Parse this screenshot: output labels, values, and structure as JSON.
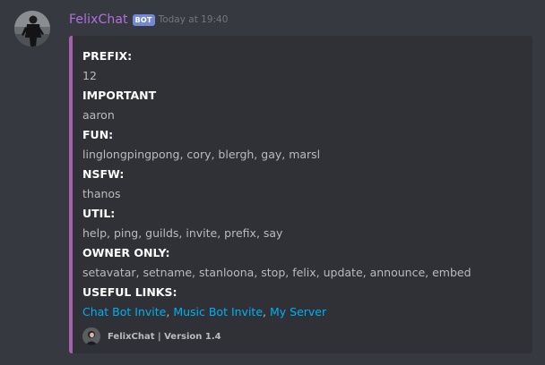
{
  "message": {
    "username": "FelixChat",
    "bot_tag": "BOT",
    "timestamp": "Today at 19:40",
    "avatar_icon": "user-avatar",
    "username_color": "#b56ee0",
    "embed_accent_color": "#a75fb0"
  },
  "embed": {
    "fields": [
      {
        "name": "PREFIX:",
        "value": "12"
      },
      {
        "name": "IMPORTANT",
        "value": "aaron"
      },
      {
        "name": "FUN:",
        "value": "linglongpingpong, cory, blergh, gay, marsl"
      },
      {
        "name": "NSFW:",
        "value": "thanos"
      },
      {
        "name": "UTIL:",
        "value": "help, ping, guilds, invite, prefix, say"
      },
      {
        "name": "OWNER ONLY:",
        "value": "setavatar, setname, stanloona, stop, felix, update, announce, embed"
      }
    ],
    "links_field": {
      "name": "USEFUL LINKS:",
      "links": [
        {
          "label": "Chat Bot Invite"
        },
        {
          "label": "Music Bot Invite"
        },
        {
          "label": "My Server"
        }
      ],
      "separator": ", ",
      "link_color": "#00b0f4"
    },
    "footer": {
      "text": "FelixChat | Version 1.4",
      "icon": "footer-avatar"
    }
  }
}
